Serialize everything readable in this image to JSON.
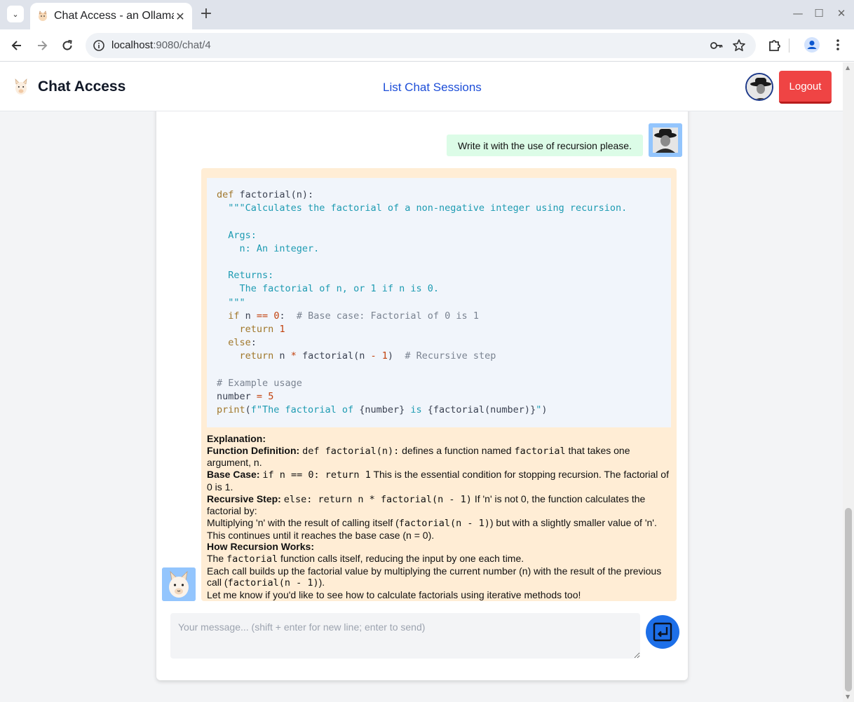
{
  "browser": {
    "tab_title": "Chat Access - an Ollama",
    "url_host": "localhost",
    "url_path": ":9080/chat/4"
  },
  "header": {
    "title": "Chat Access",
    "nav_link": "List Chat Sessions",
    "logout_label": "Logout"
  },
  "chat": {
    "user_message": "Write it with the use of recursion please.",
    "explanation": {
      "heading": "Explanation:",
      "func_def_label": "Function Definition:",
      "func_def_code": "def factorial(n):",
      "func_def_text_1": " defines a function named ",
      "func_def_code_2": "factorial",
      "func_def_text_2": " that takes one argument, n.",
      "base_case_label": "Base Case:",
      "base_case_code": "if n == 0: return 1",
      "base_case_text": " This is the essential condition for stopping recursion. The factorial of 0 is 1.",
      "recursive_label": "Recursive Step:",
      "recursive_code": "else: return n * factorial(n - 1)",
      "recursive_text": " If 'n' is not 0, the function calculates the factorial by:",
      "multiply_text_1": "Multiplying 'n' with the result of calling itself (",
      "multiply_code": "factorial(n - 1)",
      "multiply_text_2": ") but with a slightly smaller value of 'n'. This continues until it reaches the base case (n = 0).",
      "how_label": "How Recursion Works:",
      "how_text_1": "The ",
      "how_code": "factorial",
      "how_text_2": " function calls itself, reducing the input by one each time.",
      "each_call_text_1": "Each call builds up the factorial value by multiplying the current number (n) with the result of the previous call (",
      "each_call_code": "factorial(n - 1)",
      "each_call_text_2": ").",
      "closing": "Let me know if you'd like to see how to calculate factorials using iterative methods too!"
    }
  },
  "input": {
    "placeholder": "Your message... (shift + enter for new line; enter to send)"
  },
  "icons": {
    "send": "enter-key-icon",
    "tab_menu": "chevron-down-icon",
    "key": "key-icon",
    "star": "star-icon",
    "extensions": "puzzle-icon",
    "profile": "profile-icon",
    "more": "more-vert-icon"
  },
  "colors": {
    "user_bubble": "#dcfce7",
    "assistant_bubble": "#ffedd5",
    "logout": "#ef4444",
    "send_button": "#1d6fe8",
    "nav_link": "#1d4ed8"
  }
}
